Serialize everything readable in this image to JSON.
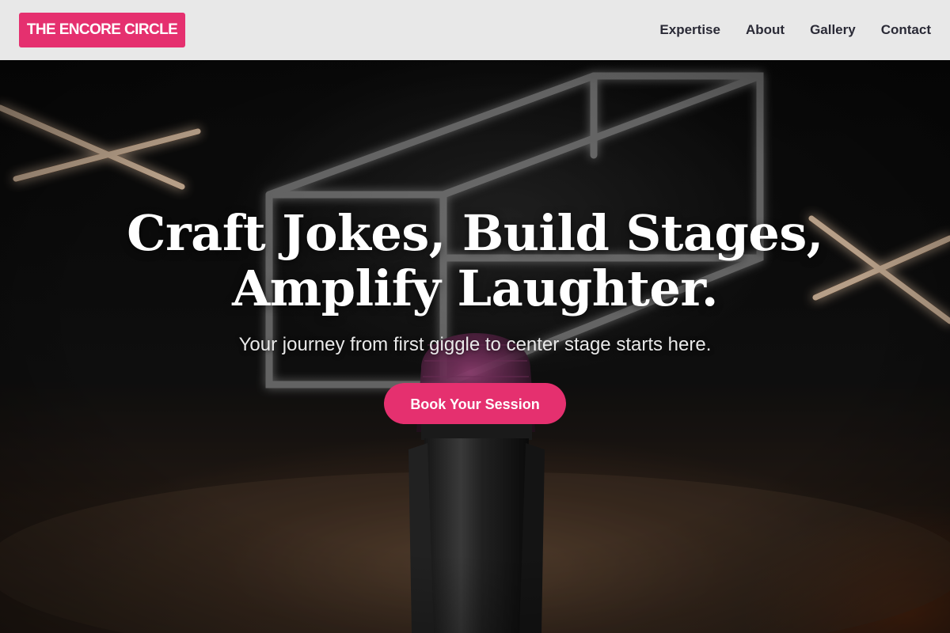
{
  "brand": {
    "logo_text": "THE ENCORE CIRCLE",
    "accent_color": "#e5306f"
  },
  "nav": {
    "items": [
      {
        "label": "Expertise"
      },
      {
        "label": "About"
      },
      {
        "label": "Gallery"
      },
      {
        "label": "Contact"
      }
    ]
  },
  "hero": {
    "headline_line1": "Craft Jokes, Build Stages,",
    "headline_line2": "Amplify Laughter.",
    "subheadline": "Your journey from first giggle to center stage starts here.",
    "cta_label": "Book Your Session",
    "background_image": "microphone-stage-neon-photo"
  }
}
